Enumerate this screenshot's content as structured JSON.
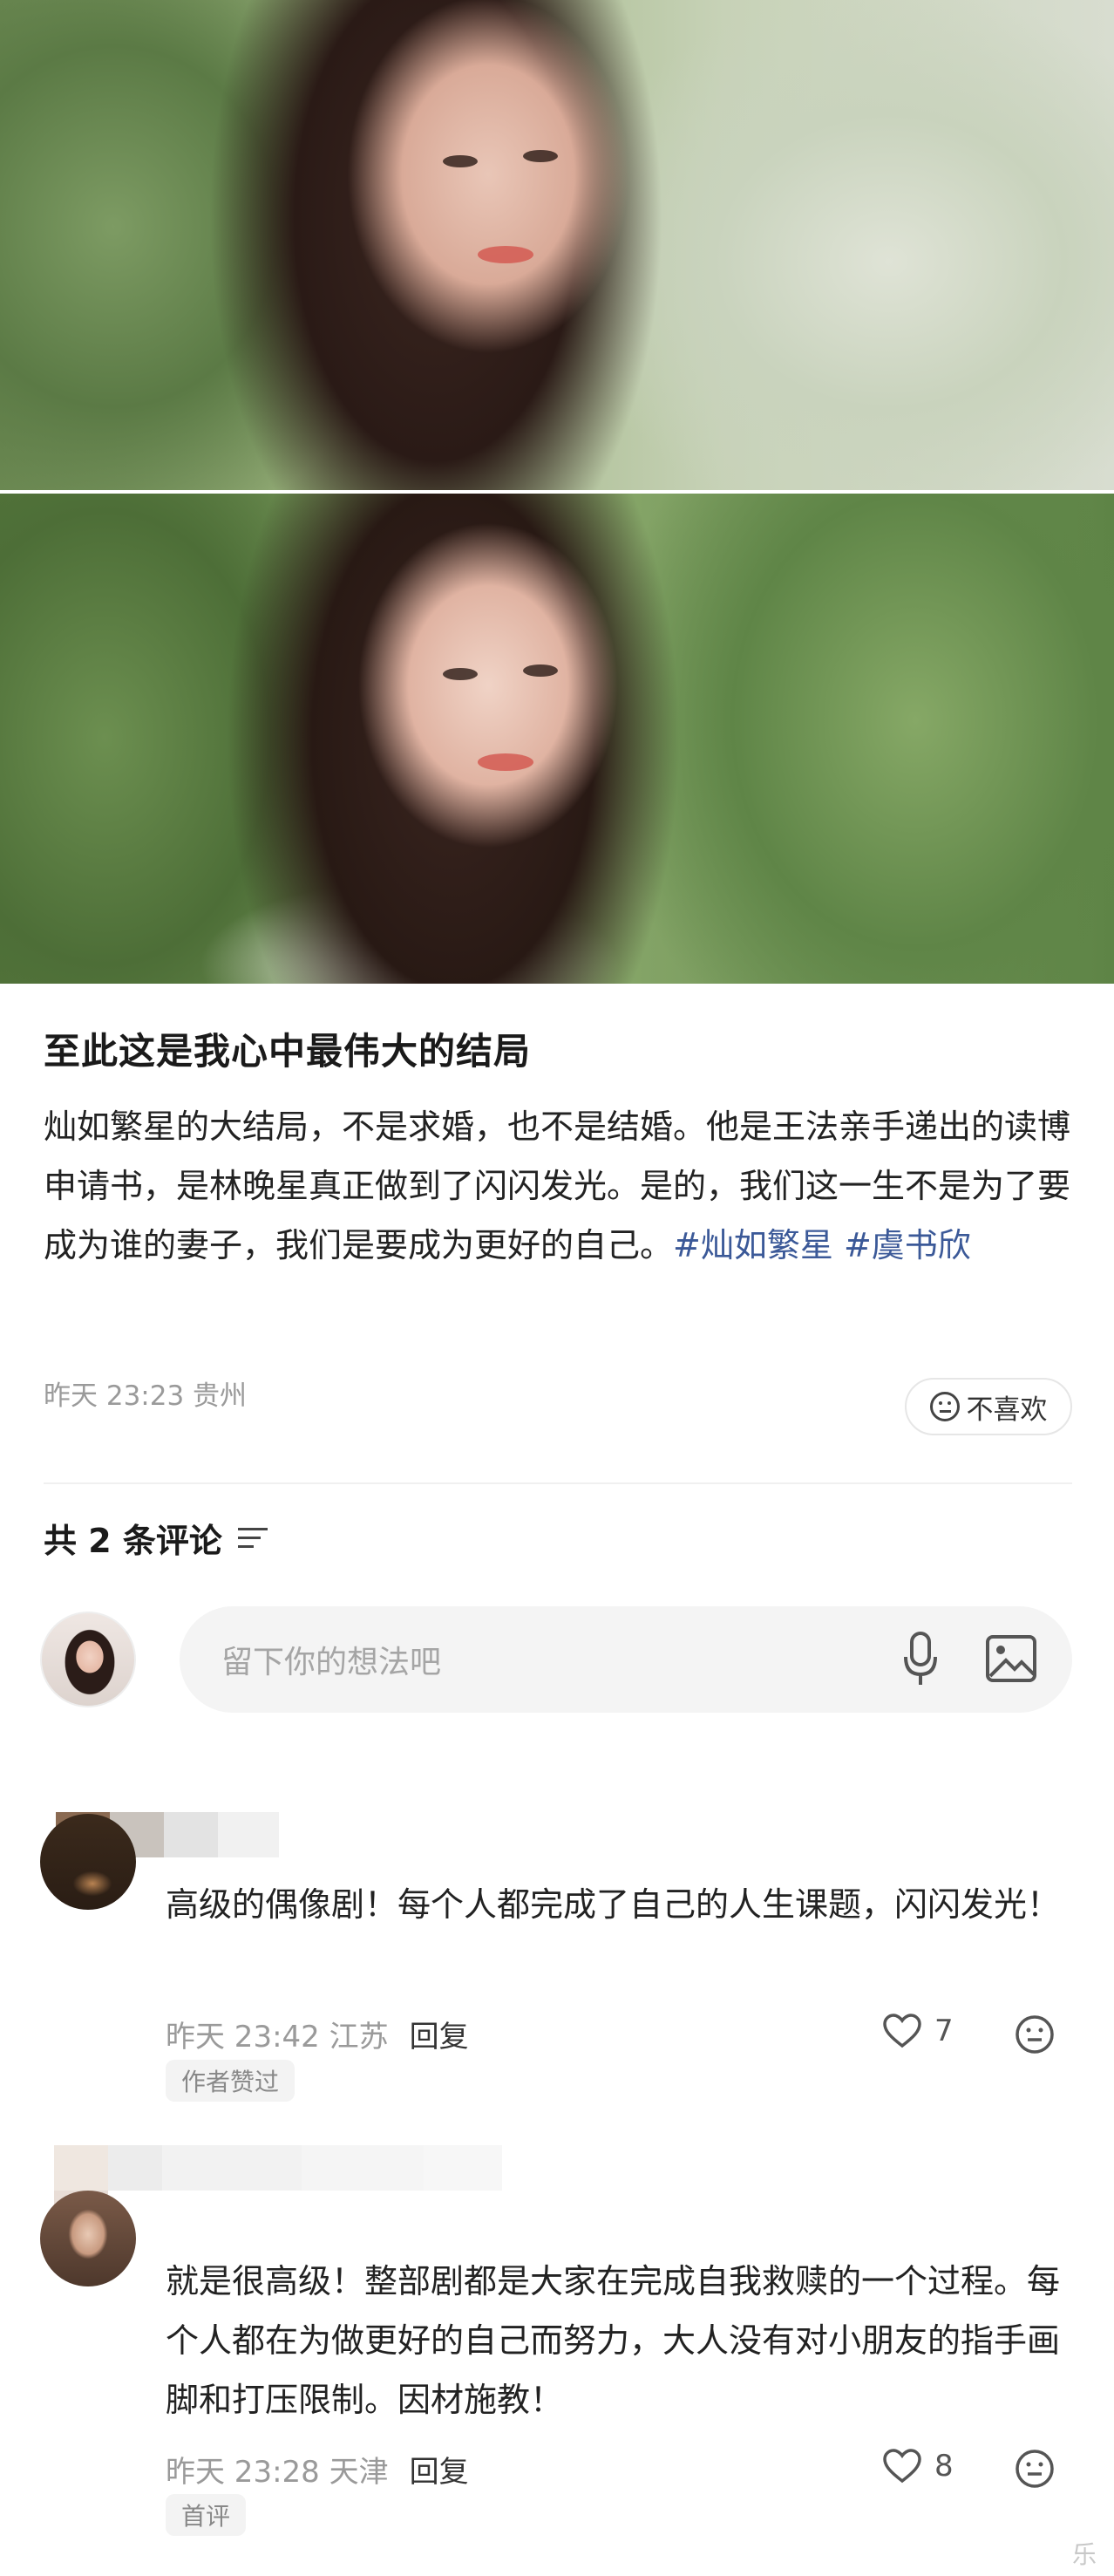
{
  "post": {
    "title": "至此这是我心中最伟大的结局",
    "body": "灿如繁星的大结局，不是求婚，也不是结婚。他是王法亲手递出的读博申请书，是林晚星真正做到了闪闪发光。是的，我们这一生不是为了要成为谁的妻子，我们是要成为更好的自己。",
    "tags": [
      "#灿如繁星",
      "#虞书欣"
    ],
    "meta": "昨天 23:23 贵州",
    "dislike_label": "不喜欢"
  },
  "comments_header": {
    "count_label": "共 2 条评论"
  },
  "composer": {
    "placeholder": "留下你的想法吧"
  },
  "comments": [
    {
      "text": "高级的偶像剧！每个人都完成了自己的人生课题，闪闪发光！",
      "time_location": "昨天 23:42 江苏",
      "reply_label": "回复",
      "likes": "7",
      "badge": "作者赞过"
    },
    {
      "text": "就是很高级！整部剧都是大家在完成自我救赎的一个过程。每个人都在为做更好的自己而努力，大人没有对小朋友的指手画脚和打压限制。因材施教！",
      "time_location": "昨天 23:28 天津",
      "reply_label": "回复",
      "likes": "8",
      "badge": "首评"
    }
  ],
  "corner_mark": "乐",
  "colors": {
    "hashtag": "#3b5998",
    "meta_gray": "#9a9a9a",
    "input_bg": "#f4f4f4"
  }
}
